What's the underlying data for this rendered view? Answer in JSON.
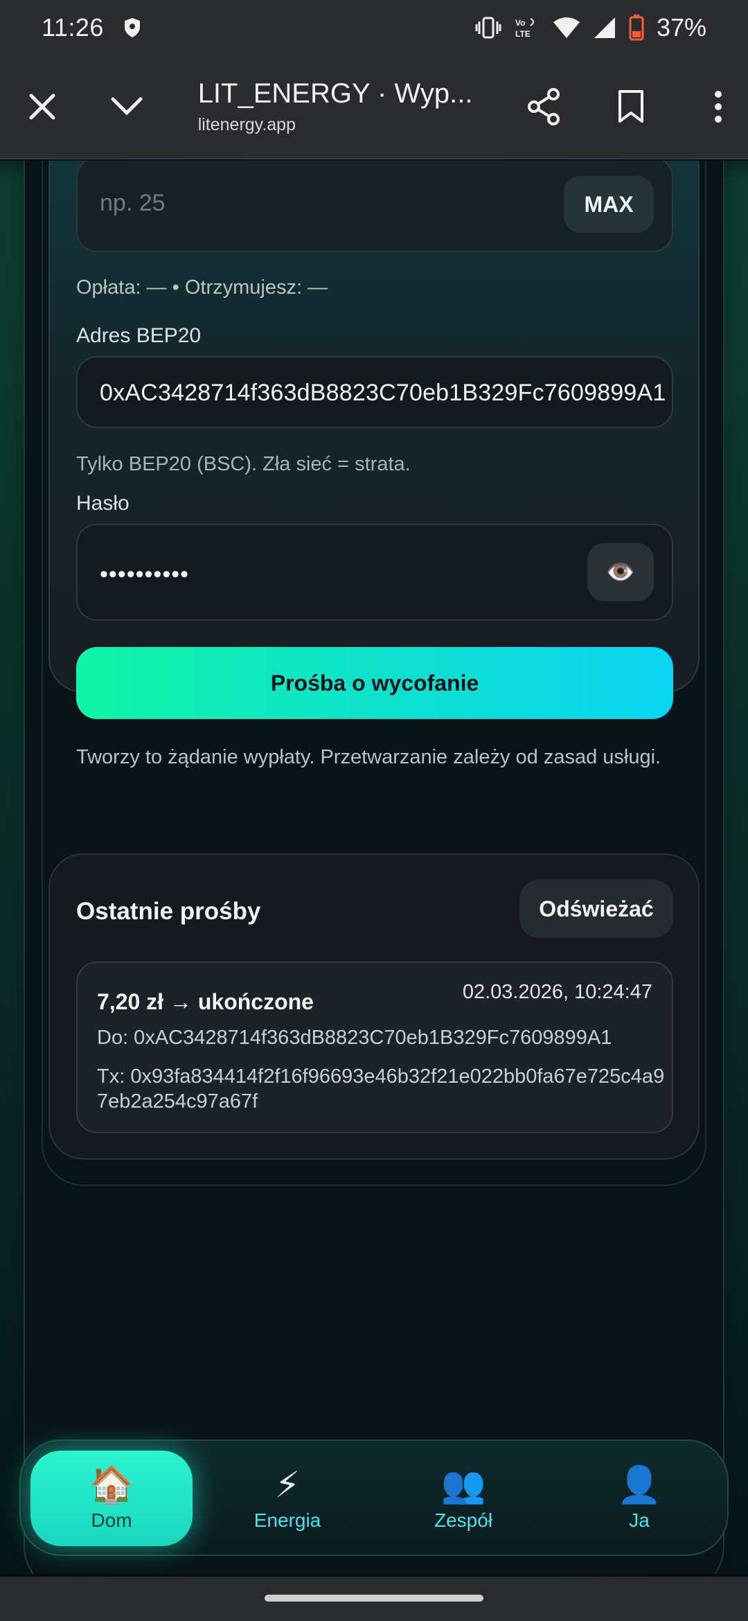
{
  "status_bar": {
    "time": "11:26",
    "battery": "37%",
    "battery_color": "#ff5a3c"
  },
  "browser": {
    "title": "LIT_ENERGY · Wyp...",
    "url": "litenergy.app"
  },
  "withdraw_form": {
    "amount_placeholder": "np. 25",
    "max_label": "MAX",
    "fee_line": "Opłata: — • Otrzymujesz: —",
    "address_label": "Adres BEP20",
    "address_value": "0xAC3428714f363dB8823C70eb1B329Fc7609899A1",
    "address_hint": "Tylko BEP20 (BSC). Zła sieć = strata.",
    "password_label": "Hasło",
    "password_value": "••••••••••",
    "eye_icon": "👁️",
    "submit_label": "Prośba o wycofanie",
    "note": "Tworzy to żądanie wypłaty. Przetwarzanie zależy od zasad usługi."
  },
  "recent_requests": {
    "title": "Ostatnie prośby",
    "refresh_label": "Odświeżać",
    "items": [
      {
        "amount_status": "7,20 zł → ukończone",
        "date": "02.03.2026, 10:24:47",
        "to": "Do: 0xAC3428714f363dB8823C70eb1B329Fc7609899A1",
        "tx": "Tx: 0x93fa834414f2f16f96693e46b32f21e022bb0fa67e725c4a97eb2a254c97a67f"
      }
    ]
  },
  "bottom_nav": {
    "items": [
      {
        "icon": "🏠",
        "label": "Dom",
        "active": true
      },
      {
        "icon": "⚡",
        "label": "Energia",
        "active": false
      },
      {
        "icon": "👥",
        "label": "Zespół",
        "active": false
      },
      {
        "icon": "👤",
        "label": "Ja",
        "active": false
      }
    ]
  },
  "colors": {
    "accent_start": "#10f5a6",
    "accent_end": "#0ad6f2",
    "nav_label": "#3fe6f4"
  }
}
